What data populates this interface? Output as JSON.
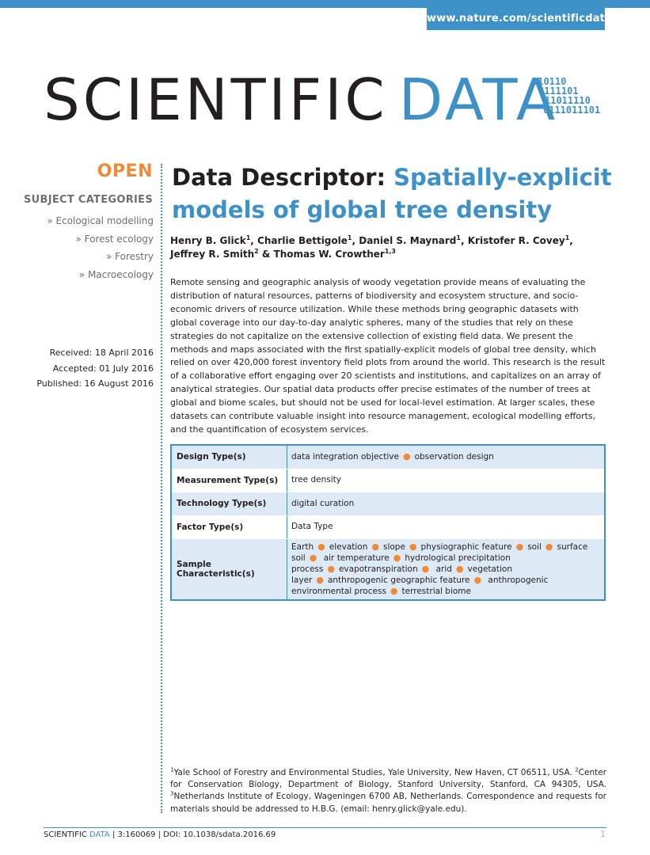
{
  "header": {
    "url": "www.nature.com/scientificdata",
    "logo_scientific": "SCIENTIFIC",
    "logo_data": "DATA",
    "binary_lines": [
      "110110",
      "0111101",
      "11011110",
      "0111011101"
    ]
  },
  "sidebar": {
    "open_label": "OPEN",
    "subject_heading": "SUBJECT CATEGORIES",
    "subjects": [
      "» Ecological modelling",
      "» Forest ecology",
      "» Forestry",
      "» Macroecology"
    ],
    "received": "Received: 18 April 2016",
    "accepted": "Accepted: 01 July 2016",
    "published": "Published: 16 August 2016"
  },
  "article": {
    "type_label": "Data Descriptor:",
    "title": "Spatially-explicit models of global tree density",
    "authors": [
      {
        "name": "Henry B. Glick",
        "aff": "1"
      },
      {
        "name": "Charlie Bettigole",
        "aff": "1"
      },
      {
        "name": "Daniel S. Maynard",
        "aff": "1"
      },
      {
        "name": "Kristofer R. Covey",
        "aff": "1"
      },
      {
        "name": "Jeffrey R. Smith",
        "aff": "2"
      },
      {
        "name": "Thomas W. Crowther",
        "aff": "1,3"
      }
    ],
    "abstract": "Remote sensing and geographic analysis of woody vegetation provide means of evaluating the distribution of natural resources, patterns of biodiversity and ecosystem structure, and socio-economic drivers of resource utilization. While these methods bring geographic datasets with global coverage into our day-to-day analytic spheres, many of the studies that rely on these strategies do not capitalize on the extensive collection of existing field data. We present the methods and maps associated with the first spatially-explicit models of global tree density, which relied on over 420,000 forest inventory field plots from around the world. This research is the result of a collaborative effort engaging over 20 scientists and institutions, and capitalizes on an array of analytical strategies. Our spatial data products offer precise estimates of the number of trees at global and biome scales, but should not be used for local-level estimation. At larger scales, these datasets can contribute valuable insight into resource management, ecological modelling efforts, and the quantification of ecosystem services."
  },
  "metadata_table": {
    "rows": [
      {
        "key": "Design Type(s)",
        "values": [
          "data integration objective",
          "observation design"
        ]
      },
      {
        "key": "Measurement Type(s)",
        "values": [
          "tree density"
        ]
      },
      {
        "key": "Technology Type(s)",
        "values": [
          "digital curation"
        ]
      },
      {
        "key": "Factor Type(s)",
        "values": [
          "Data Type"
        ]
      },
      {
        "key": "Sample Characteristic(s)",
        "values": [
          "Earth",
          "elevation",
          "slope",
          "physiographic feature",
          "soil",
          "surface soil",
          "air temperature",
          "hydrological precipitation process",
          "evapotranspiration",
          "arid",
          "vegetation layer",
          "anthropogenic geographic feature",
          "anthropogenic environmental process",
          "terrestrial biome"
        ]
      }
    ]
  },
  "footnote": {
    "aff1_mark": "1",
    "aff1": "Yale School of Forestry and Environmental Studies, Yale University, New Haven, CT 06511, USA.",
    "aff2_mark": "2",
    "aff2": "Center for Conservation Biology, Department of Biology, Stanford University, Stanford, CA 94305, USA.",
    "aff3_mark": "3",
    "aff3": "Netherlands Institute of Ecology, Wageningen 6700 AB, Netherlands. Correspondence and requests for materials should be addressed to H.B.G. (email: henry.glick@yale.edu)."
  },
  "footer": {
    "journal_plain": "SCIENTIFIC",
    "journal_blue": "DATA",
    "citation": "| 3:160069 | DOI: 10.1038/sdata.2016.69",
    "page_number": "1"
  },
  "colors": {
    "accent_blue": "#3d91c6",
    "accent_orange": "#f18a36",
    "table_shade": "#dde9f4"
  }
}
